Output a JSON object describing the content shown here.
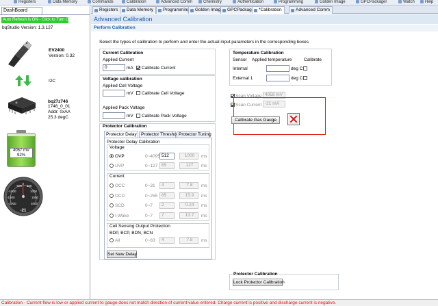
{
  "toolbar": {
    "items": [
      "Registers",
      "Data Memory",
      "Commands",
      "Calibration",
      "Advanced Comm",
      "Chemistry",
      "Authentication",
      "Programming",
      "Golden Image",
      "GPCPackager",
      "Watch",
      "Help"
    ]
  },
  "dashboard": {
    "tab_label": "DashBoard",
    "autorefresh": "Auto Refresh is ON - Click to Turn Off",
    "version": "bqStudio Version:  1.3.127",
    "ev_name": "EV2400",
    "ev_version": "Version: 0.32",
    "bus": "I2C",
    "device": "bq27z746",
    "device_fw": "1746_0_01",
    "device_addr": "Addr: 0xAA",
    "device_temp": "25.3 degC",
    "battery_voltage": "4057 mV",
    "battery_pct": "92%",
    "battery_level": 0.92,
    "gauge_labels": [
      "-500",
      "0",
      "500",
      "-1000",
      "1000",
      "-1500",
      "1500",
      "-2000",
      "2000"
    ],
    "gauge_value": "-21"
  },
  "tabs": [
    "Registers",
    "Data Memory",
    "Programming",
    "Golden Image",
    "GPCPackager",
    "*Calibration",
    "Advanced Comm"
  ],
  "header": {
    "title": "Advanced Calibration",
    "subtitle": "Perform Calibration",
    "instructions": "Select the types of calibration to perform and enter the actual input parameters in the corresponding boxes"
  },
  "current_cal": {
    "title": "Current Calibration",
    "applied_label": "Applied Current",
    "value": "0",
    "unit": "mA",
    "checkbox_label": "Calibrate Current"
  },
  "voltage_cal": {
    "title": "Voltage calibration",
    "cell_label": "Applied Cell Voltage",
    "cell_unit": "mV",
    "cell_check": "Calibrate Cell Voltage",
    "pack_label": "Applied Pack Voltage",
    "pack_unit": "mV",
    "pack_check": "Calibrate Pack Voltage"
  },
  "protector_cal": {
    "title": "Protector Calibration",
    "tabs": [
      "Protector Delay",
      "Protector Threshold",
      "Protector Tuning"
    ],
    "delay_title": "Protector Delay Calibration",
    "voltage_title": "Voltage",
    "current_title": "Current",
    "sensing_title": "Cell Sensing Output Protection",
    "sensing_list": "BDP, BCP, BDN, BCN",
    "unit": "ms",
    "rows": [
      {
        "name": "OVP",
        "range": "0~4095",
        "input": "512",
        "out": "1000"
      },
      {
        "name": "UVP",
        "range": "0~127",
        "input": "65",
        "out": "127"
      },
      {
        "name": "OCC",
        "range": "0~31",
        "input": "4",
        "out": "7.8"
      },
      {
        "name": "OCD",
        "range": "0~255",
        "input": "65",
        "out": "15.9"
      },
      {
        "name": "SCD",
        "range": "0~7",
        "input": "2",
        "out": "0.24"
      },
      {
        "name": "I-Wake",
        "range": "0~7",
        "input": "7",
        "out": "13.7"
      },
      {
        "name": "All",
        "range": "0~63",
        "input": "4",
        "out": "7.8"
      }
    ],
    "set_button": "Set New Delay"
  },
  "temp_cal": {
    "title": "Temperature Calibration",
    "col_sensor": "Sensor",
    "col_applied": "Applied temperature",
    "col_cal": "Calibrate",
    "rows": [
      {
        "sensor": "Internal",
        "unit": "deg C"
      },
      {
        "sensor": "External 1",
        "unit": "deg C"
      }
    ]
  },
  "scan": {
    "voltage_label": "Scan Voltage",
    "voltage_value": "4058 mV",
    "current_label": "Scan Current",
    "current_value": "-21 mA"
  },
  "gauge_button": "Calibrate Gas Gauge",
  "protector_lock": {
    "title": "Protector Calibration",
    "button": "Lock Protector Calibration"
  },
  "status_message": "Calibration - Current flow is low or applied current to gauge does not match direction of current value entered.  Charge current is positive and discharge current is negative.",
  "colors": {
    "accent": "#1f5fa8",
    "autorefresh_bg": "#2ecc2e",
    "error": "#e01515",
    "highlight_box": "#e0201a"
  }
}
